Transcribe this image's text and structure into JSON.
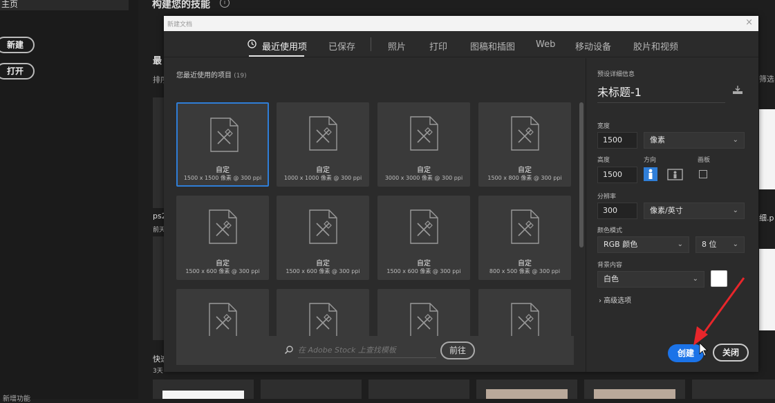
{
  "background": {
    "home_label": "主页",
    "new_button": "新建",
    "open_button": "打开",
    "page_title": "构建您的技能",
    "info_symbol": "i",
    "recent_heading_partial": "最",
    "sort_partial": "排序",
    "filter_partial": "筛选",
    "file1_name_partial": "ps2",
    "file1_time_partial": "前天",
    "file2_name_partial": "细.p",
    "file3_name_partial": "快速",
    "file3_time_partial": "3天",
    "bottom_left_partial": "新增功能"
  },
  "dialog": {
    "title": "新建文档",
    "close_symbol": "×",
    "tabs": [
      {
        "label": "最近使用项",
        "active": true
      },
      {
        "label": "已保存",
        "active": false
      },
      {
        "label": "照片",
        "active": false
      },
      {
        "label": "打印",
        "active": false
      },
      {
        "label": "图稿和插图",
        "active": false
      },
      {
        "label": "Web",
        "active": false
      },
      {
        "label": "移动设备",
        "active": false
      },
      {
        "label": "胶片和视频",
        "active": false
      }
    ],
    "recent": {
      "label": "您最近使用的项目",
      "count": "(19)",
      "items": [
        {
          "name": "自定",
          "size": "1500 x 1500 像素 @ 300 ppi",
          "selected": true
        },
        {
          "name": "自定",
          "size": "1000 x 1000 像素 @ 300 ppi",
          "selected": false
        },
        {
          "name": "自定",
          "size": "3000 x 3000 像素 @ 300 ppi",
          "selected": false
        },
        {
          "name": "自定",
          "size": "1500 x 800 像素 @ 300 ppi",
          "selected": false
        },
        {
          "name": "自定",
          "size": "1500 x 600 像素 @ 300 ppi",
          "selected": false
        },
        {
          "name": "自定",
          "size": "1500 x 600 像素 @ 300 ppi",
          "selected": false
        },
        {
          "name": "自定",
          "size": "1500 x 600 像素 @ 300 ppi",
          "selected": false
        },
        {
          "name": "自定",
          "size": "800 x 500 像素 @ 300 ppi",
          "selected": false
        },
        {
          "name": "",
          "size": "",
          "selected": false
        },
        {
          "name": "",
          "size": "",
          "selected": false
        },
        {
          "name": "",
          "size": "",
          "selected": false
        },
        {
          "name": "",
          "size": "",
          "selected": false
        }
      ]
    },
    "stock": {
      "placeholder": "在 Adobe Stock 上查找模板",
      "go_label": "前往"
    },
    "details": {
      "section_label": "预设详细信息",
      "doc_name": "未标题-1",
      "width_label": "宽度",
      "width_value": "1500",
      "width_unit": "像素",
      "height_label": "高度",
      "height_value": "1500",
      "orientation_label": "方向",
      "artboard_label": "画板",
      "resolution_label": "分辨率",
      "resolution_value": "300",
      "resolution_unit": "像素/英寸",
      "color_mode_label": "颜色模式",
      "color_mode_value": "RGB 颜色",
      "bit_depth_value": "8 位",
      "background_label": "背景内容",
      "background_value": "白色",
      "advanced_label": "高级选项",
      "create_label": "创建",
      "close_label": "关闭"
    }
  },
  "colors": {
    "accent": "#1b73e8",
    "selection": "#2f7ed8",
    "annotation_arrow": "#e8262b"
  }
}
